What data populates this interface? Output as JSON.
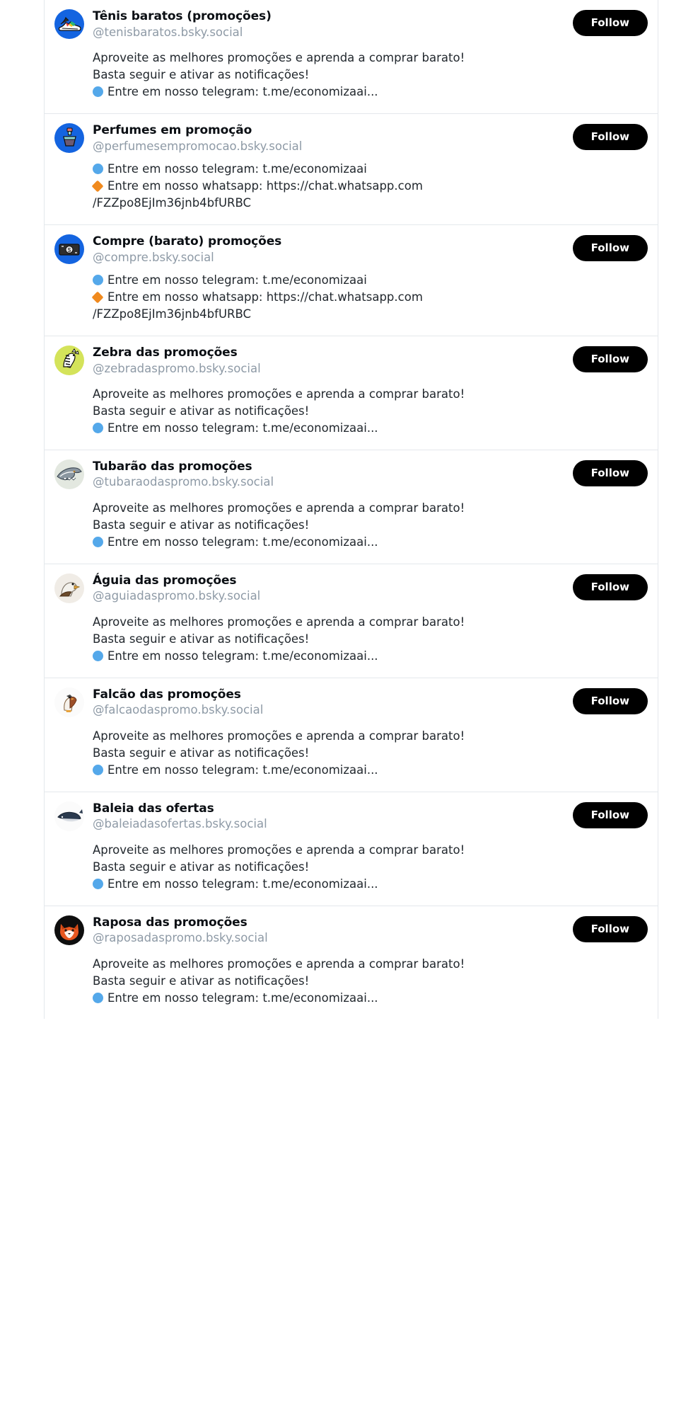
{
  "feed": {
    "follow_label": "Follow",
    "accent_follow_bg": "#000000",
    "accent_follow_fg": "#ffffff",
    "telegram_bullet_color": "#54a8ea",
    "whatsapp_bullet_color": "#f08a1e",
    "cards": [
      {
        "display_name": "Tênis baratos (promoções)",
        "handle": "@tenisbaratos.bsky.social",
        "avatar_icon": "sneaker-icon",
        "avatar_bg": "#1464e0",
        "line1": "Aproveite as melhores promoções e aprenda a comprar barato!",
        "line2": "Basta seguir e ativar as notificações!",
        "telegram": "Entre em nosso telegram: t.me/economizaai...",
        "whatsapp": "",
        "whatsapp_cont": ""
      },
      {
        "display_name": "Perfumes em promoção",
        "handle": "@perfumesempromocao.bsky.social",
        "avatar_icon": "perfume-bottle-icon",
        "avatar_bg": "#1464e0",
        "line1": "",
        "line2": "",
        "telegram": "Entre em nosso telegram: t.me/economizaai",
        "whatsapp": "Entre em nosso whatsapp: https://chat.whatsapp.com",
        "whatsapp_cont": "/FZZpo8EjIm36jnb4bfURBC"
      },
      {
        "display_name": "Compre (barato) promoções",
        "handle": "@compre.bsky.social",
        "avatar_icon": "money-icon",
        "avatar_bg": "#1464e0",
        "line1": "",
        "line2": "",
        "telegram": "Entre em nosso telegram: t.me/economizaai",
        "whatsapp": "Entre em nosso whatsapp: https://chat.whatsapp.com",
        "whatsapp_cont": "/FZZpo8EjIm36jnb4bfURBC"
      },
      {
        "display_name": "Zebra das promoções",
        "handle": "@zebradaspromo.bsky.social",
        "avatar_icon": "zebra-icon",
        "avatar_bg": "#d4e35a",
        "line1": "Aproveite as melhores promoções e aprenda a comprar barato!",
        "line2": "Basta seguir e ativar as notificações!",
        "telegram": "Entre em nosso telegram: t.me/economizaai...",
        "whatsapp": "",
        "whatsapp_cont": ""
      },
      {
        "display_name": "Tubarão das promoções",
        "handle": "@tubaraodaspromo.bsky.social",
        "avatar_icon": "shark-icon",
        "avatar_bg": "#e3e8e0",
        "line1": "Aproveite as melhores promoções e aprenda a comprar barato!",
        "line2": "Basta seguir e ativar as notificações!",
        "telegram": "Entre em nosso telegram: t.me/economizaai...",
        "whatsapp": "",
        "whatsapp_cont": ""
      },
      {
        "display_name": "Águia das promoções",
        "handle": "@aguiadaspromo.bsky.social",
        "avatar_icon": "eagle-icon",
        "avatar_bg": "#f0ece6",
        "line1": "Aproveite as melhores promoções e aprenda a comprar barato!",
        "line2": "Basta seguir e ativar as notificações!",
        "telegram": "Entre em nosso telegram: t.me/economizaai...",
        "whatsapp": "",
        "whatsapp_cont": ""
      },
      {
        "display_name": "Falcão das promoções",
        "handle": "@falcaodaspromo.bsky.social",
        "avatar_icon": "falcon-icon",
        "avatar_bg": "#fbfbfb",
        "line1": "Aproveite as melhores promoções e aprenda a comprar barato!",
        "line2": "Basta seguir e ativar as notificações!",
        "telegram": "Entre em nosso telegram: t.me/economizaai...",
        "whatsapp": "",
        "whatsapp_cont": ""
      },
      {
        "display_name": "Baleia das ofertas",
        "handle": "@baleiadasofertas.bsky.social",
        "avatar_icon": "whale-icon",
        "avatar_bg": "#fbfbfb",
        "line1": "Aproveite as melhores promoções e aprenda a comprar barato!",
        "line2": "Basta seguir e ativar as notificações!",
        "telegram": "Entre em nosso telegram: t.me/economizaai...",
        "whatsapp": "",
        "whatsapp_cont": ""
      },
      {
        "display_name": "Raposa das promoções",
        "handle": "@raposadaspromo.bsky.social",
        "avatar_icon": "fox-icon",
        "avatar_bg": "#0e0e0e",
        "line1": "Aproveite as melhores promoções e aprenda a comprar barato!",
        "line2": "Basta seguir e ativar as notificações!",
        "telegram": "Entre em nosso telegram: t.me/economizaai...",
        "whatsapp": "",
        "whatsapp_cont": ""
      }
    ]
  }
}
